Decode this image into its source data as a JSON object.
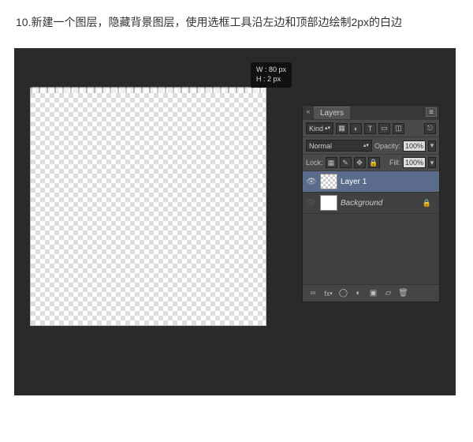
{
  "instruction": "10.新建一个图层，隐藏背景图层，使用选框工具沿左边和顶部边绘制2px的白边",
  "tooltip": {
    "w_label": "W : 80 px",
    "h_label": "H : 2 px"
  },
  "panel": {
    "title": "Layers",
    "filter_label": "Kind",
    "blend_mode": "Normal",
    "opacity_label": "Opacity:",
    "opacity_value": "100%",
    "lock_label": "Lock:",
    "fill_label": "Fill:",
    "fill_value": "100%",
    "layers": [
      {
        "name": "Layer 1",
        "visible": true,
        "selected": true,
        "thumb": "checker"
      },
      {
        "name": "Background",
        "visible": false,
        "selected": false,
        "thumb": "white",
        "locked": true
      }
    ],
    "footer": {
      "link_label": "∞",
      "fx_label": "fx",
      "mask_label": "◯",
      "group_label": "▣",
      "adjust_label": "◐",
      "new_label": "▱",
      "trash_label": "🗑"
    }
  }
}
